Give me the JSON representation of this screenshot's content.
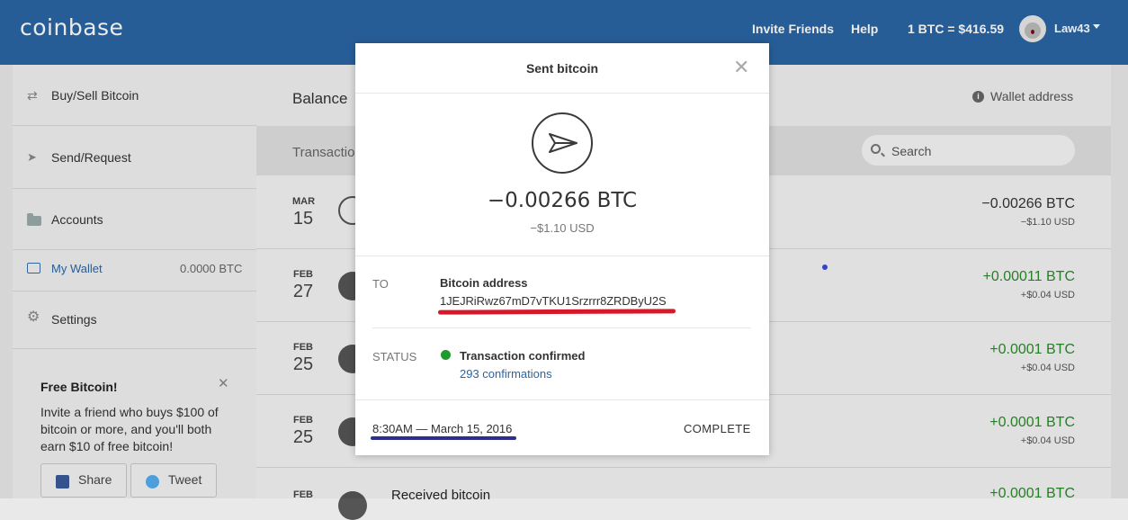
{
  "header": {
    "logo": "coinbase",
    "invite": "Invite Friends",
    "help": "Help",
    "price": "1 BTC = $416.59",
    "user": "Law43"
  },
  "sidebar": {
    "items": [
      {
        "label": "Buy/Sell Bitcoin",
        "icon": "shuffle-icon"
      },
      {
        "label": "Send/Request",
        "icon": "send-icon"
      },
      {
        "label": "Accounts",
        "icon": "folder-icon"
      },
      {
        "label": "My Wallet",
        "value": "0.0000 BTC",
        "icon": "wallet-icon"
      },
      {
        "label": "Settings",
        "icon": "gear-icon"
      }
    ]
  },
  "promo": {
    "title": "Free Bitcoin!",
    "text": "Invite a friend who buys $100 of bitcoin or more, and you'll both earn $10 of free bitcoin!",
    "share": "Share",
    "tweet": "Tweet"
  },
  "main": {
    "balance_title": "Balance",
    "wallet_address": "Wallet address",
    "transactions_title": "Transactions",
    "search_placeholder": "Search",
    "rows": [
      {
        "month": "MAR",
        "day": "15",
        "amount": "−0.00266 BTC",
        "usd": "−$1.10 USD",
        "type": "sent"
      },
      {
        "month": "FEB",
        "day": "27",
        "amount": "+0.00011 BTC",
        "usd": "+$0.04 USD",
        "type": "received"
      },
      {
        "month": "FEB",
        "day": "25",
        "amount": "+0.0001 BTC",
        "usd": "+$0.04 USD",
        "type": "received"
      },
      {
        "month": "FEB",
        "day": "25",
        "amount": "+0.0001 BTC",
        "usd": "+$0.04 USD",
        "type": "received"
      },
      {
        "month": "FEB",
        "day": "",
        "amount": "+0.0001 BTC",
        "usd": "",
        "type": "received",
        "desc": "Received bitcoin"
      }
    ]
  },
  "modal": {
    "title": "Sent bitcoin",
    "amount": "−0.00266 BTC",
    "usd": "−$1.10 USD",
    "to_label": "TO",
    "address_title": "Bitcoin address",
    "address": "1JEJRiRwz67mD7vTKU1Srzrrr8ZRDByU2S",
    "status_label": "STATUS",
    "status_title": "Transaction confirmed",
    "confirmations": "293 confirmations",
    "datetime": "8:30AM — March 15, 2016",
    "state": "COMPLETE"
  },
  "colors": {
    "brand": "#2b65a4",
    "positive": "#2a8a2a",
    "confirmed": "#1f9a2e",
    "annotation_red": "#d5192a",
    "annotation_blue": "#2c2f8e"
  }
}
